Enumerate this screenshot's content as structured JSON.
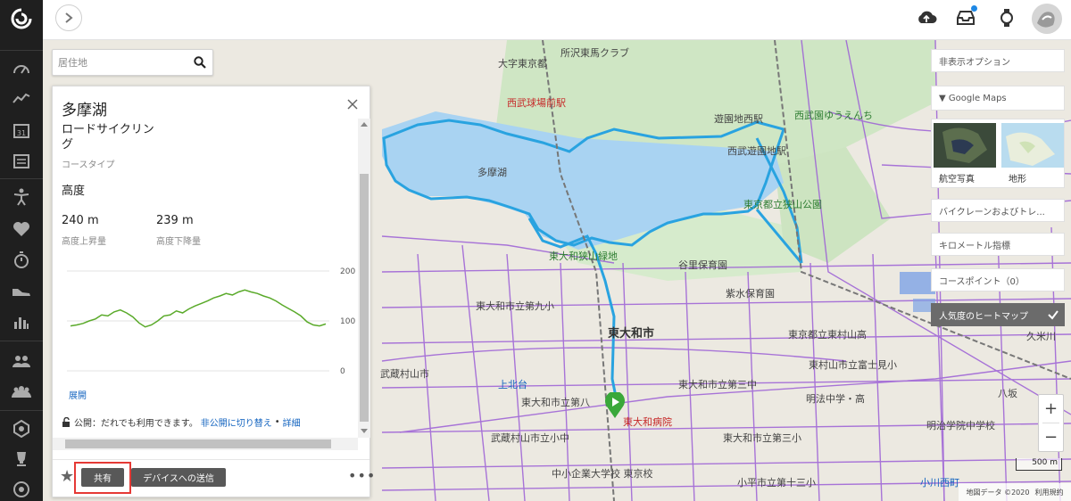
{
  "header": {
    "expand_icon": "chevron-right-icon",
    "upload_icon": "cloud-upload-icon",
    "inbox_icon": "inbox-icon",
    "watch_icon": "watch-icon"
  },
  "sidebar": {
    "items": [
      {
        "icon": "speedometer-icon"
      },
      {
        "icon": "activity-line-icon"
      },
      {
        "icon": "calendar-icon",
        "text": "31"
      },
      {
        "icon": "report-icon"
      },
      {
        "icon": "person-training-icon"
      },
      {
        "icon": "heart-icon"
      },
      {
        "icon": "stopwatch-icon"
      },
      {
        "icon": "shoe-icon"
      },
      {
        "icon": "bar-chart-icon"
      },
      {
        "icon": "connections-icon"
      },
      {
        "icon": "groups-icon"
      },
      {
        "icon": "badge-icon"
      },
      {
        "icon": "trophy-icon"
      },
      {
        "icon": "target-icon"
      }
    ]
  },
  "search": {
    "placeholder": "居住地"
  },
  "panel": {
    "title": "多摩湖",
    "route_type": "ロードサイクリング",
    "route_type_label": "コースタイプ",
    "elevation_heading": "高度",
    "ascent_value": "240 m",
    "ascent_label": "高度上昇量",
    "descent_value": "239 m",
    "descent_label": "高度下降量",
    "expand_label": "展開",
    "privacy_text": "公開：だれでも利用できます。",
    "privacy_link": "非公開に切り替え",
    "privacy_sep": "•",
    "details_link": "詳細",
    "share_button": "共有",
    "send_to_device_button": "デバイスへの送信",
    "more_label": "•••",
    "star_label": "★"
  },
  "layers": {
    "hide_options": "非表示オプション",
    "google_maps": "▼ Google Maps",
    "satellite": "航空写真",
    "terrain": "地形",
    "bike_lanes": "バイクレーンおよびトレ...",
    "km_markers": "キロメートル指標",
    "course_points": "コースポイント（0）",
    "heatmap": "人気度のヒートマップ"
  },
  "map": {
    "zoom_in": "+",
    "zoom_out": "−",
    "scale": "500 m",
    "attribution": "地図データ ©2020",
    "terms": "利用規約",
    "labels": [
      {
        "text": "所沢東馬クラブ",
        "cls": ""
      },
      {
        "text": "大字東京都",
        "cls": ""
      },
      {
        "text": "西武球場前駅",
        "cls": "red"
      },
      {
        "text": "遊園地西駅",
        "cls": ""
      },
      {
        "text": "西武園ゆうえんち",
        "cls": "green"
      },
      {
        "text": "西武遊園地駅",
        "cls": ""
      },
      {
        "text": "多摩湖",
        "cls": ""
      },
      {
        "text": "東京都立狭山公園",
        "cls": "green"
      },
      {
        "text": "東大和狭山緑地",
        "cls": "green"
      },
      {
        "text": "谷里保育園",
        "cls": ""
      },
      {
        "text": "紫水保育園",
        "cls": ""
      },
      {
        "text": "東大和市",
        "cls": "bold"
      },
      {
        "text": "東大和市立第九小",
        "cls": ""
      },
      {
        "text": "東京都立東村山高",
        "cls": ""
      },
      {
        "text": "東村山市立富士見小",
        "cls": ""
      },
      {
        "text": "東大和市立第三中",
        "cls": ""
      },
      {
        "text": "明法中学・高",
        "cls": ""
      },
      {
        "text": "明治学院中学校",
        "cls": ""
      },
      {
        "text": "東大和市立第八",
        "cls": ""
      },
      {
        "text": "東大和病院",
        "cls": "red"
      },
      {
        "text": "東大和市立第三小",
        "cls": ""
      },
      {
        "text": "武蔵村山市立小中",
        "cls": ""
      },
      {
        "text": "中小企業大学校 東京校",
        "cls": ""
      },
      {
        "text": "小平市立第十三小",
        "cls": ""
      },
      {
        "text": "小川西町",
        "cls": "blue"
      },
      {
        "text": "武蔵村山市",
        "cls": ""
      },
      {
        "text": "上北台",
        "cls": "blue"
      },
      {
        "text": "八坂",
        "cls": ""
      },
      {
        "text": "久米川",
        "cls": ""
      }
    ]
  },
  "chart_data": {
    "type": "line",
    "yticks": [
      200,
      100,
      0
    ],
    "ylim": [
      0,
      200
    ],
    "series": [
      {
        "values": [
          90,
          92,
          95,
          100,
          104,
          112,
          110,
          118,
          122,
          116,
          108,
          96,
          88,
          92,
          100,
          110,
          112,
          120,
          116,
          124,
          130,
          135,
          140,
          146,
          150,
          155,
          152,
          158,
          162,
          158,
          155,
          150,
          146,
          140,
          132,
          125,
          118,
          110,
          98,
          92,
          90,
          94
        ]
      }
    ]
  }
}
